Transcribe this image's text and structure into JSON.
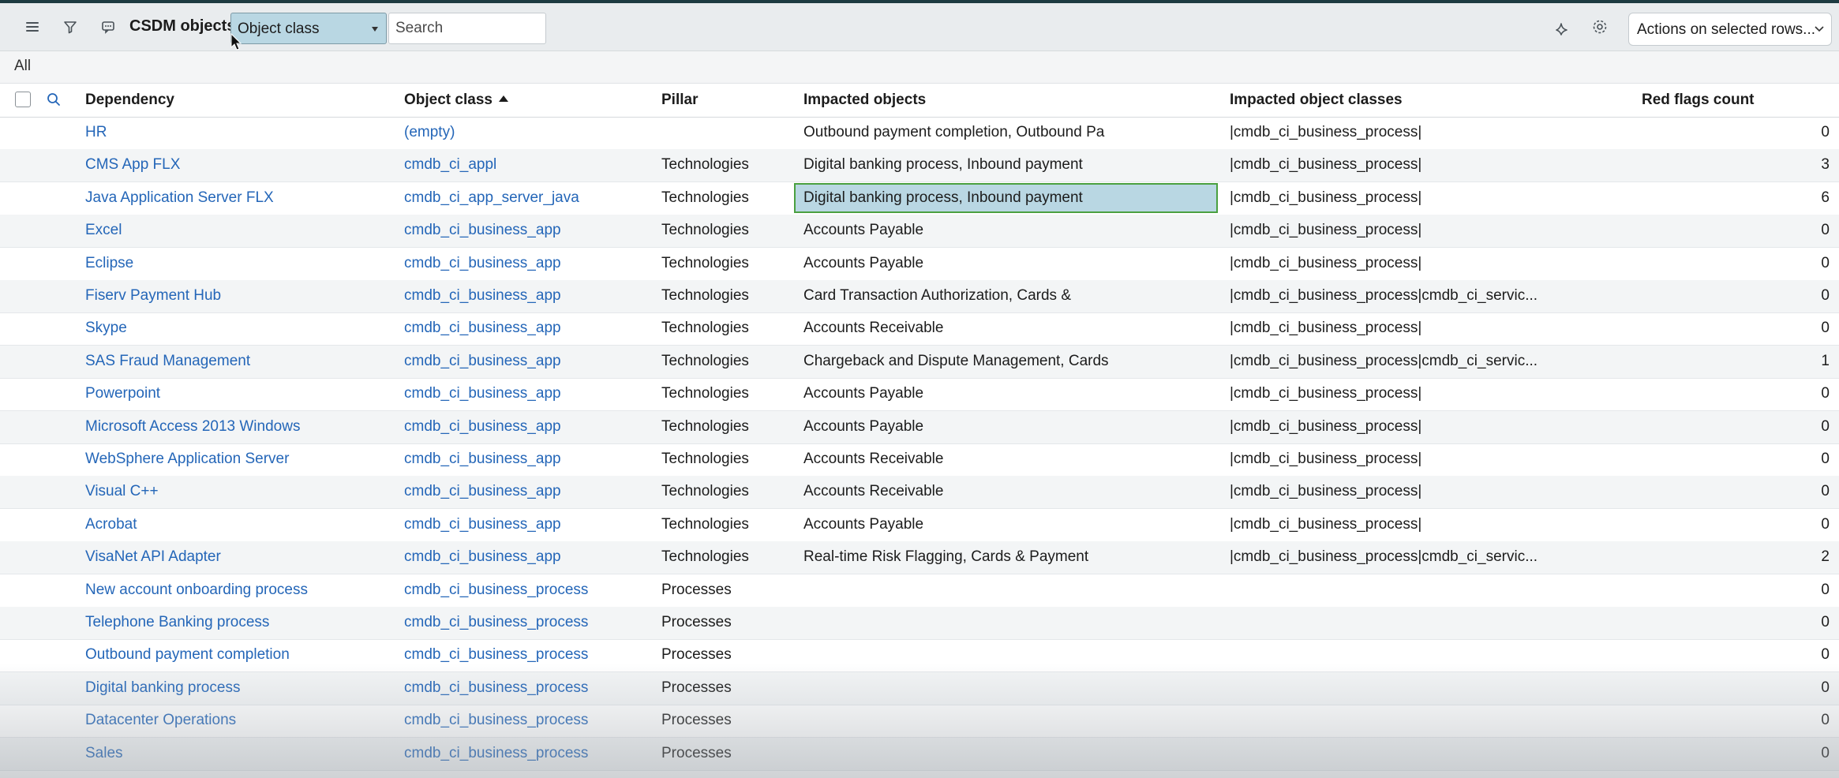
{
  "toolbar": {
    "title": "CSDM objects",
    "field_select": "Object class",
    "search_placeholder": "Search",
    "actions_label": "Actions on selected rows..."
  },
  "filter": {
    "breadcrumb": "All"
  },
  "columns": {
    "dependency": "Dependency",
    "object_class": "Object class",
    "pillar": "Pillar",
    "impacted_objects": "Impacted objects",
    "impacted_object_classes": "Impacted object classes",
    "red_flags": "Red flags count"
  },
  "rows": [
    {
      "dependency": "HR",
      "object_class": "(empty)",
      "pillar": "",
      "impacted_objects": "Outbound payment completion, Outbound Pa",
      "impacted_object_classes": "|cmdb_ci_business_process|",
      "red_flags": "0"
    },
    {
      "dependency": "CMS App FLX",
      "object_class": "cmdb_ci_appl",
      "pillar": "Technologies",
      "impacted_objects": "Digital banking process, Inbound payment",
      "impacted_object_classes": "|cmdb_ci_business_process|",
      "red_flags": "3"
    },
    {
      "dependency": "Java Application Server FLX",
      "object_class": "cmdb_ci_app_server_java",
      "pillar": "Technologies",
      "impacted_objects": "Digital banking process, Inbound payment",
      "impacted_object_classes": "|cmdb_ci_business_process|",
      "red_flags": "6"
    },
    {
      "dependency": "Excel",
      "object_class": "cmdb_ci_business_app",
      "pillar": "Technologies",
      "impacted_objects": "Accounts Payable",
      "impacted_object_classes": "|cmdb_ci_business_process|",
      "red_flags": "0"
    },
    {
      "dependency": "Eclipse",
      "object_class": "cmdb_ci_business_app",
      "pillar": "Technologies",
      "impacted_objects": "Accounts Payable",
      "impacted_object_classes": "|cmdb_ci_business_process|",
      "red_flags": "0"
    },
    {
      "dependency": "Fiserv Payment Hub",
      "object_class": "cmdb_ci_business_app",
      "pillar": "Technologies",
      "impacted_objects": "Card Transaction Authorization, Cards &",
      "impacted_object_classes": "|cmdb_ci_business_process|cmdb_ci_servic...",
      "red_flags": "0"
    },
    {
      "dependency": "Skype",
      "object_class": "cmdb_ci_business_app",
      "pillar": "Technologies",
      "impacted_objects": "Accounts Receivable",
      "impacted_object_classes": "|cmdb_ci_business_process|",
      "red_flags": "0"
    },
    {
      "dependency": "SAS Fraud Management",
      "object_class": "cmdb_ci_business_app",
      "pillar": "Technologies",
      "impacted_objects": "Chargeback and Dispute Management, Cards",
      "impacted_object_classes": "|cmdb_ci_business_process|cmdb_ci_servic...",
      "red_flags": "1"
    },
    {
      "dependency": "Powerpoint",
      "object_class": "cmdb_ci_business_app",
      "pillar": "Technologies",
      "impacted_objects": "Accounts Payable",
      "impacted_object_classes": "|cmdb_ci_business_process|",
      "red_flags": "0"
    },
    {
      "dependency": "Microsoft Access 2013 Windows",
      "object_class": "cmdb_ci_business_app",
      "pillar": "Technologies",
      "impacted_objects": "Accounts Payable",
      "impacted_object_classes": "|cmdb_ci_business_process|",
      "red_flags": "0"
    },
    {
      "dependency": "WebSphere Application Server",
      "object_class": "cmdb_ci_business_app",
      "pillar": "Technologies",
      "impacted_objects": "Accounts Receivable",
      "impacted_object_classes": "|cmdb_ci_business_process|",
      "red_flags": "0"
    },
    {
      "dependency": "Visual C++",
      "object_class": "cmdb_ci_business_app",
      "pillar": "Technologies",
      "impacted_objects": "Accounts Receivable",
      "impacted_object_classes": "|cmdb_ci_business_process|",
      "red_flags": "0"
    },
    {
      "dependency": "Acrobat",
      "object_class": "cmdb_ci_business_app",
      "pillar": "Technologies",
      "impacted_objects": "Accounts Payable",
      "impacted_object_classes": "|cmdb_ci_business_process|",
      "red_flags": "0"
    },
    {
      "dependency": "VisaNet API Adapter",
      "object_class": "cmdb_ci_business_app",
      "pillar": "Technologies",
      "impacted_objects": "Real-time Risk Flagging, Cards & Payment",
      "impacted_object_classes": "|cmdb_ci_business_process|cmdb_ci_servic...",
      "red_flags": "2"
    },
    {
      "dependency": "New account onboarding process",
      "object_class": "cmdb_ci_business_process",
      "pillar": "Processes",
      "impacted_objects": "",
      "impacted_object_classes": "",
      "red_flags": "0"
    },
    {
      "dependency": "Telephone Banking process",
      "object_class": "cmdb_ci_business_process",
      "pillar": "Processes",
      "impacted_objects": "",
      "impacted_object_classes": "",
      "red_flags": "0"
    },
    {
      "dependency": "Outbound payment completion",
      "object_class": "cmdb_ci_business_process",
      "pillar": "Processes",
      "impacted_objects": "",
      "impacted_object_classes": "",
      "red_flags": "0"
    },
    {
      "dependency": "Digital banking process",
      "object_class": "cmdb_ci_business_process",
      "pillar": "Processes",
      "impacted_objects": "",
      "impacted_object_classes": "",
      "red_flags": "0"
    },
    {
      "dependency": "Datacenter Operations",
      "object_class": "cmdb_ci_business_process",
      "pillar": "Processes",
      "impacted_objects": "",
      "impacted_object_classes": "",
      "red_flags": "0"
    },
    {
      "dependency": "Sales",
      "object_class": "cmdb_ci_business_process",
      "pillar": "Processes",
      "impacted_objects": "",
      "impacted_object_classes": "",
      "red_flags": "0"
    }
  ],
  "selected_cell": {
    "row": 2,
    "column": "impacted_objects"
  },
  "colors": {
    "link": "#2466b8",
    "selected_bg": "#b9d7e3",
    "selected_border": "#4aa040",
    "toolbar_bg": "#e9ecee"
  },
  "icons": [
    "hamburger-menu-icon",
    "filter-icon",
    "comment-icon",
    "sparkle-icon",
    "gear-icon",
    "chevron-down-icon",
    "search-icon"
  ]
}
